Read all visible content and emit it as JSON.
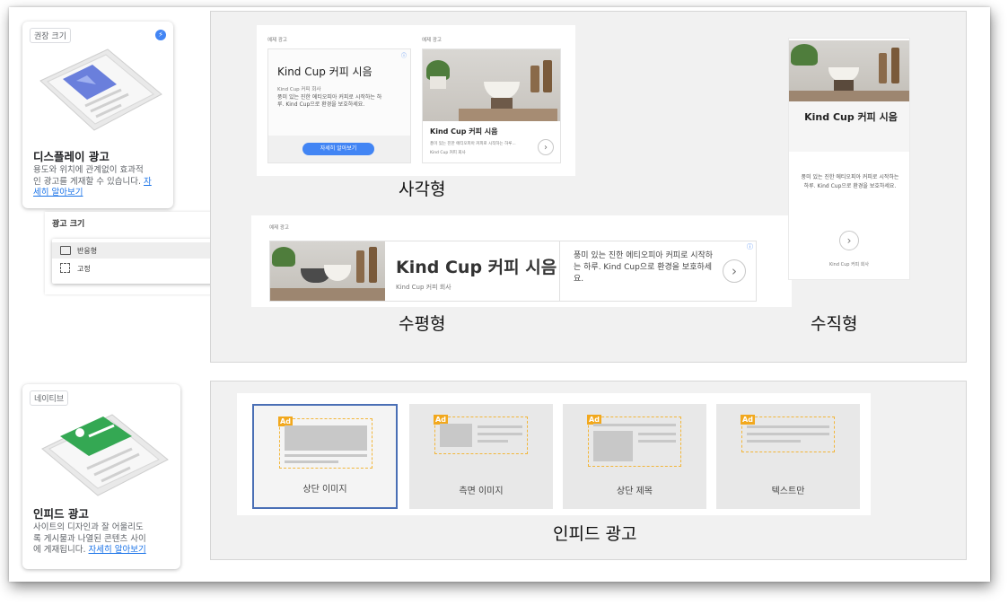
{
  "display_card": {
    "chip": "권장 크기",
    "title": "디스플레이 광고",
    "desc_line1": "용도와 위치에 관계없이 효과적",
    "desc_line2": "인 광고를 게재할 수 있습니다.",
    "link_part1": "자",
    "link_part2": "세히 알아보기"
  },
  "ad_size": {
    "title": "광고 크기",
    "option_responsive": "반응형",
    "option_fixed": "고정"
  },
  "infeed_card": {
    "chip": "네이티브",
    "title": "인피드 광고",
    "desc_line1": "사이트의 디자인과 잘 어울리도",
    "desc_line2": "록 게시물과 나열된 콘텐츠 사이",
    "desc_line3": "에 게재됩니다.",
    "link": "자세히 알아보기"
  },
  "square": {
    "label": "사각형",
    "example1": "예제 광고",
    "example2": "예제 광고",
    "ad1_title": "Kind Cup 커피 시음",
    "ad1_company": "Kind Cup 커피 회사",
    "ad1_body": "풍미 있는 진한 에티오피아 커피로 시작하는 하루. Kind Cup으로 환경을 보호하세요.",
    "ad1_button": "자세히 알아보기",
    "ad2_title": "Kind Cup 커피 시음",
    "ad2_body": "풍미 있는 진한 에티오피아 커피로 시작하는 하루...",
    "ad2_company": "Kind Cup 커피 회사"
  },
  "horizontal": {
    "label": "수평형",
    "example": "예제 광고",
    "title": "Kind Cup 커피 시음",
    "company": "Kind Cup 커피 회사",
    "body": "풍미 있는 진한 에티오피아 커피로 시작하는 하루. Kind Cup으로 환경을 보호하세요."
  },
  "vertical": {
    "label": "수직형",
    "title": "Kind Cup 커피 시음",
    "body": "풍미 있는 진한 에티오피아 커피로 시작하는 하루. Kind Cup으로 환경을 보호하세요.",
    "company": "Kind Cup 커피 회사"
  },
  "infeed": {
    "label": "인피드 광고",
    "tiles": [
      "상단 이미지",
      "측면 이미지",
      "상단 제목",
      "텍스트만"
    ],
    "ad_tag": "Ad"
  },
  "colors": {
    "accent": "#4285f4",
    "native_green": "#34a853",
    "ad_tag": "#f2a81d",
    "selected_border": "#4a6fb5"
  }
}
